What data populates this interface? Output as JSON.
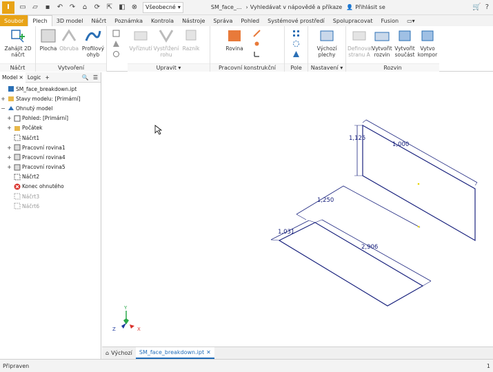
{
  "titlebar": {
    "app_logo": "I",
    "appearance_dropdown": "Všeobecné",
    "doc_title": "SM_face_...",
    "help_search": "Vyhledávat v nápovědě a příkaze",
    "signin": "Přihlásit se"
  },
  "tabs": [
    {
      "label": "Soubor"
    },
    {
      "label": "Plech"
    },
    {
      "label": "3D model"
    },
    {
      "label": "Náčrt"
    },
    {
      "label": "Poznámka"
    },
    {
      "label": "Kontrola"
    },
    {
      "label": "Nástroje"
    },
    {
      "label": "Správa"
    },
    {
      "label": "Pohled"
    },
    {
      "label": "Systémové prostředí"
    },
    {
      "label": "Spolupracovat"
    },
    {
      "label": "Fusion"
    }
  ],
  "ribbon": {
    "sketch_panel": {
      "title": "Náčrt",
      "start_sketch": "Zahájit 2D náčrt"
    },
    "create_panel": {
      "title": "Vytvoření",
      "face": "Plocha",
      "contour_flange": "Obruba",
      "contour_roll": "Profilový ohyb"
    },
    "modify_panel": {
      "title": "Upravit",
      "cut": "Vyříznutí",
      "corner_round": "Vystřižení rohu",
      "punch": "Razník"
    },
    "workfeatures_panel": {
      "title": "Pracovní konstrukční prvky",
      "plane": "Rovina"
    },
    "pattern_panel": {
      "title": "Pole"
    },
    "setup_panel": {
      "title": "Nastavení",
      "default_sheet": "Výchozí plechy"
    },
    "flat_panel": {
      "title": "Rozvin",
      "define_a_side": "Definovat stranu A",
      "create_flat": "Vytvořit rozvin",
      "create_part": "Vytvořit součást",
      "create_component": "Vytvo kompor"
    }
  },
  "browser": {
    "tabs": [
      {
        "label": "Model"
      },
      {
        "label": "Logic"
      }
    ],
    "tree": [
      {
        "label": "SM_face_breakdown.ipt",
        "icon": "part-icon",
        "exp": "",
        "level": 0
      },
      {
        "label": "Stavy modelu: [Primární]",
        "icon": "folder-icon",
        "exp": "+",
        "level": 0
      },
      {
        "label": "Ohnutý model",
        "icon": "sheetmetal-icon",
        "exp": "−",
        "level": 0
      },
      {
        "label": "Pohled: [Primární]",
        "icon": "view-icon",
        "exp": "+",
        "level": 1
      },
      {
        "label": "Počátek",
        "icon": "folder-icon",
        "exp": "+",
        "level": 1
      },
      {
        "label": "Náčrt1",
        "icon": "sketch-icon",
        "exp": "",
        "level": 1
      },
      {
        "label": "Pracovní rovina1",
        "icon": "workplane-icon",
        "exp": "+",
        "level": 1
      },
      {
        "label": "Pracovní rovina4",
        "icon": "workplane-icon",
        "exp": "+",
        "level": 1
      },
      {
        "label": "Pracovní rovina5",
        "icon": "workplane-icon",
        "exp": "+",
        "level": 1
      },
      {
        "label": "Náčrt2",
        "icon": "sketch-icon",
        "exp": "",
        "level": 1
      },
      {
        "label": "Konec ohnutého",
        "icon": "end-of-part-icon",
        "exp": "",
        "level": 1
      },
      {
        "label": "Náčrt3",
        "icon": "sketch-icon",
        "exp": "",
        "level": 1,
        "dim": true
      },
      {
        "label": "Náčrt6",
        "icon": "sketch-icon",
        "exp": "",
        "level": 1,
        "dim": true
      }
    ]
  },
  "viewport": {
    "dims": {
      "d1": "1,125",
      "d2": "1,000",
      "d3": "1,250",
      "d4": "1,031",
      "d5": "2,906"
    },
    "axes": {
      "x": "X",
      "y": "Y",
      "z": "Z"
    }
  },
  "doc_tabs": [
    {
      "label": "Výchozí"
    },
    {
      "label": "SM_face_breakdown.ipt"
    }
  ],
  "status": {
    "left": "Připraven",
    "right": "1"
  },
  "colors": {
    "file_tab": "#e8a317",
    "sketch_line": "#1a237e",
    "accent": "#1e6bb8"
  }
}
